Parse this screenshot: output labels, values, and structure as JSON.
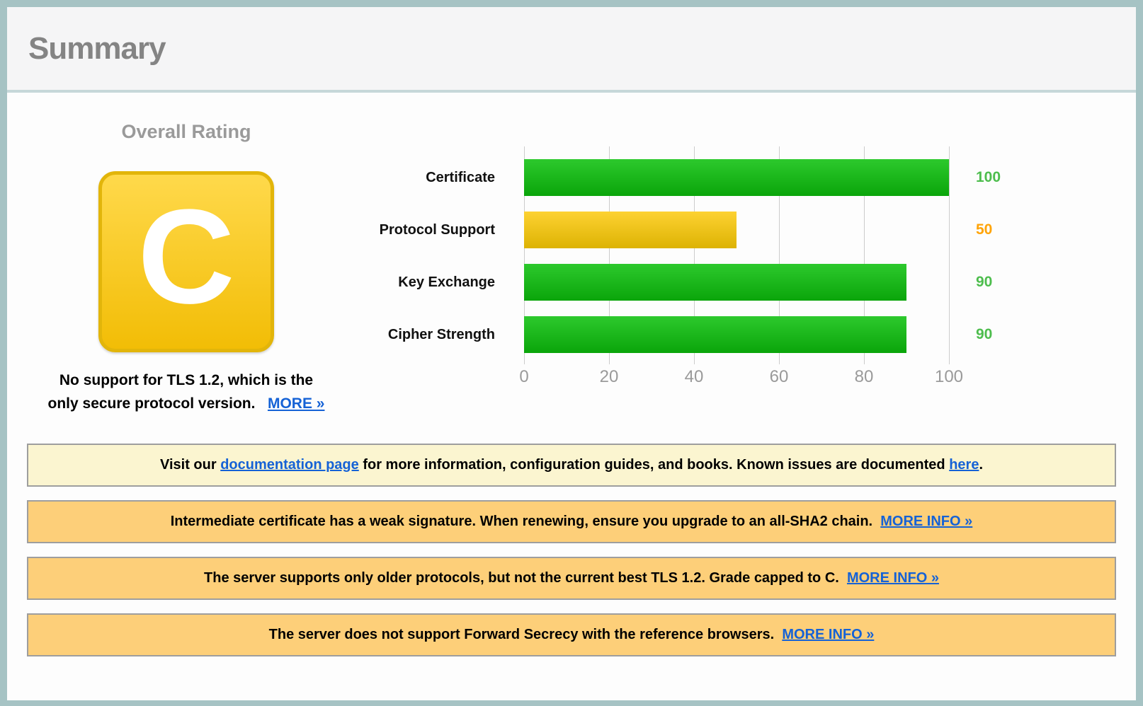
{
  "page": {
    "title": "Summary"
  },
  "overall_rating": {
    "label": "Overall Rating",
    "grade": "C",
    "note_line1": "No support for TLS 1.2, which is the",
    "note_line2": "only secure protocol version.",
    "more_link": "MORE »"
  },
  "chart_data": {
    "type": "bar",
    "orientation": "horizontal",
    "categories": [
      "Certificate",
      "Protocol Support",
      "Key Exchange",
      "Cipher Strength"
    ],
    "values": [
      100,
      50,
      90,
      90
    ],
    "bar_styles": [
      "green",
      "yellow",
      "green",
      "green"
    ],
    "value_label_colors": [
      "#4dbd4d",
      "#ffa408",
      "#4dbd4d",
      "#4dbd4d"
    ],
    "xlim": [
      0,
      100
    ],
    "x_ticks": [
      "0",
      "20",
      "40",
      "60",
      "80",
      "100"
    ],
    "grid": true,
    "colors": {
      "green_bar": "#1db41d",
      "yellow_bar": "#eec31a"
    }
  },
  "messages": [
    {
      "style": "note",
      "parts": [
        {
          "text": "Visit our "
        },
        {
          "text": "documentation page",
          "link": true,
          "name": "documentation-page-link"
        },
        {
          "text": " for more information, configuration guides, and books. Known issues are documented "
        },
        {
          "text": "here",
          "link": true,
          "name": "known-issues-link"
        },
        {
          "text": "."
        }
      ]
    },
    {
      "style": "warning",
      "parts": [
        {
          "text": "Intermediate certificate has a weak signature. When renewing, ensure you upgrade to an all-SHA2 chain."
        },
        {
          "text": "  "
        },
        {
          "text": "MORE INFO »",
          "link": true,
          "name": "more-info-link-weak-signature"
        }
      ]
    },
    {
      "style": "warning",
      "parts": [
        {
          "text": "The server supports only older protocols, but not the current best TLS 1.2. Grade capped to C."
        },
        {
          "text": "  "
        },
        {
          "text": "MORE INFO »",
          "link": true,
          "name": "more-info-link-grade-capped"
        }
      ]
    },
    {
      "style": "warning",
      "parts": [
        {
          "text": "The server does not support Forward Secrecy with the reference browsers."
        },
        {
          "text": "  "
        },
        {
          "text": "MORE INFO »",
          "link": true,
          "name": "more-info-link-forward-secrecy"
        }
      ]
    }
  ]
}
